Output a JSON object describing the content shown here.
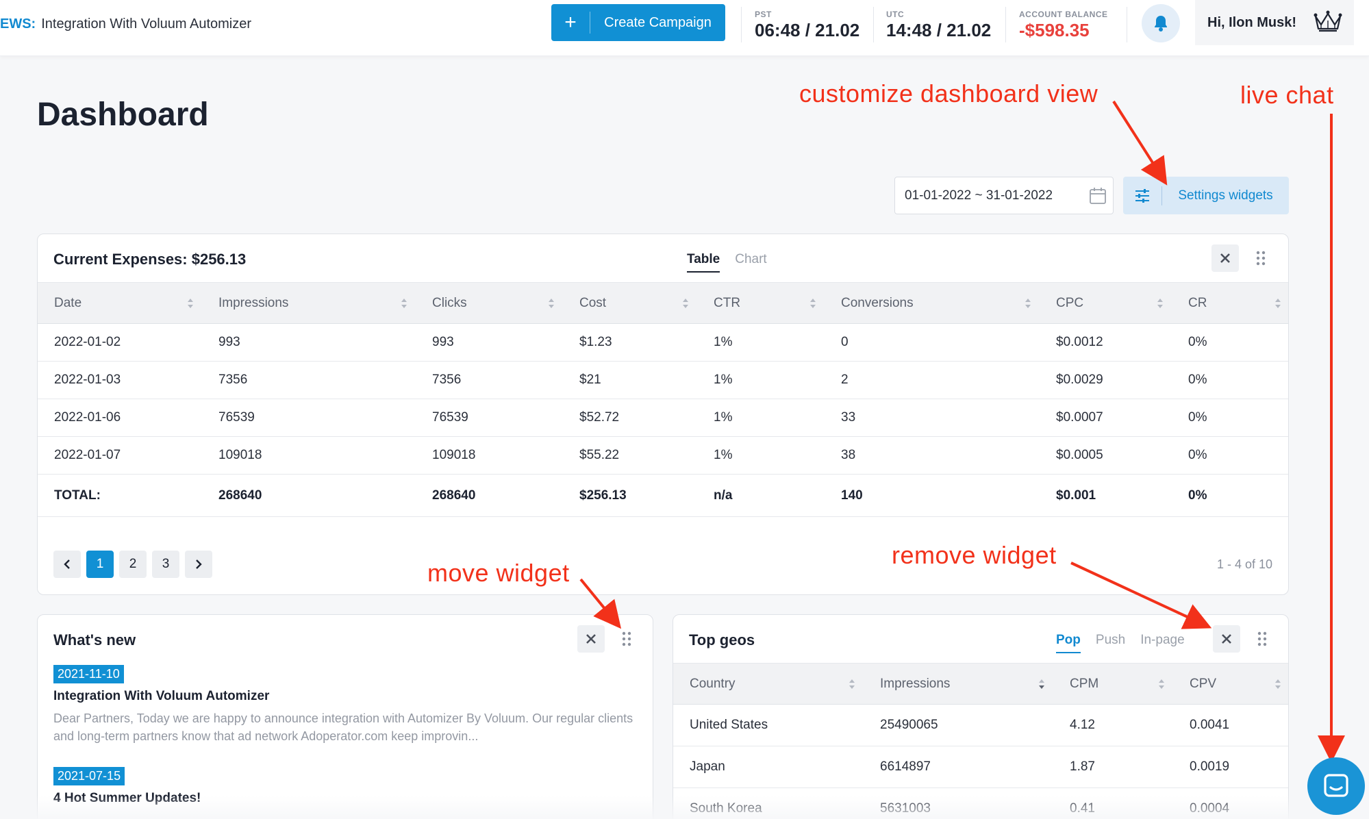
{
  "topbar": {
    "news_prefix": "EWS:",
    "news_text": "Integration With Voluum Automizer",
    "create_campaign": "Create Campaign",
    "create_icon": "+",
    "clocks": [
      {
        "label": "PST",
        "value": "06:48 / 21.02"
      },
      {
        "label": "UTC",
        "value": "14:48 / 21.02"
      }
    ],
    "balance": {
      "label": "ACCOUNT BALANCE",
      "value": "-$598.35",
      "color": "#e8413c"
    },
    "greeting": "Hi, Ilon Musk!",
    "icons": {
      "bell": "bell-icon",
      "crown": "crown-icon"
    }
  },
  "page": {
    "title": "Dashboard",
    "date_range": "01-01-2022 ~ 31-01-2022",
    "settings_widgets": "Settings widgets"
  },
  "expenses": {
    "title": "Current Expenses: $256.13",
    "tabs": [
      "Table",
      "Chart"
    ],
    "active_tab": "Table",
    "columns": [
      "Date",
      "Impressions",
      "Clicks",
      "Cost",
      "CTR",
      "Conversions",
      "CPC",
      "CR"
    ],
    "rows": [
      [
        "2022-01-02",
        "993",
        "993",
        "$1.23",
        "1%",
        "0",
        "$0.0012",
        "0%"
      ],
      [
        "2022-01-03",
        "7356",
        "7356",
        "$21",
        "1%",
        "2",
        "$0.0029",
        "0%"
      ],
      [
        "2022-01-06",
        "76539",
        "76539",
        "$52.72",
        "1%",
        "33",
        "$0.0007",
        "0%"
      ],
      [
        "2022-01-07",
        "109018",
        "109018",
        "$55.22",
        "1%",
        "38",
        "$0.0005",
        "0%"
      ]
    ],
    "total": [
      "TOTAL:",
      "268640",
      "268640",
      "$256.13",
      "n/a",
      "140",
      "$0.001",
      "0%"
    ],
    "pages": [
      "1",
      "2",
      "3"
    ],
    "current_page": "1",
    "pager_info": "1 - 4 of 10"
  },
  "whats_new": {
    "title": "What's new",
    "items": [
      {
        "date": "2021-11-10",
        "title": "Integration With Voluum Automizer",
        "body": "Dear Partners, Today we are happy to announce integration with Automizer By Voluum. Our regular clients and long-term partners know that ad network Adoperator.com keep improvin..."
      },
      {
        "date": "2021-07-15",
        "title": "4 Hot Summer Updates!"
      }
    ]
  },
  "top_geos": {
    "title": "Top geos",
    "tabs": [
      "Pop",
      "Push",
      "In-page"
    ],
    "active_tab": "Pop",
    "columns": [
      "Country",
      "Impressions",
      "CPM",
      "CPV"
    ],
    "rows": [
      [
        "United States",
        "25490065",
        "4.12",
        "0.0041"
      ],
      [
        "Japan",
        "6614897",
        "1.87",
        "0.0019"
      ],
      [
        "South Korea",
        "5631003",
        "0.41",
        "0.0004"
      ]
    ]
  },
  "annotations": {
    "customize": "customize dashboard view",
    "live_chat": "live chat",
    "move_widget": "move widget",
    "remove_widget": "remove widget",
    "color": "#f2311a"
  },
  "colors": {
    "accent": "#1190d4",
    "negative": "#e8413c"
  }
}
